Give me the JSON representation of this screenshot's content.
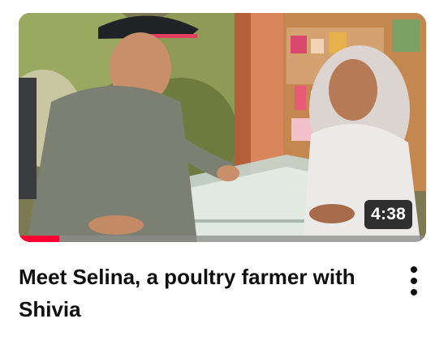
{
  "video": {
    "title": "Meet Selina, a poultry farmer with Shivia",
    "duration": "4:38",
    "watch_progress": 0.1,
    "progress_color": "#ff0033",
    "thumbnail_subject": "two women talking across a shop counter"
  },
  "menu": {
    "icon": "more-vert-icon"
  }
}
